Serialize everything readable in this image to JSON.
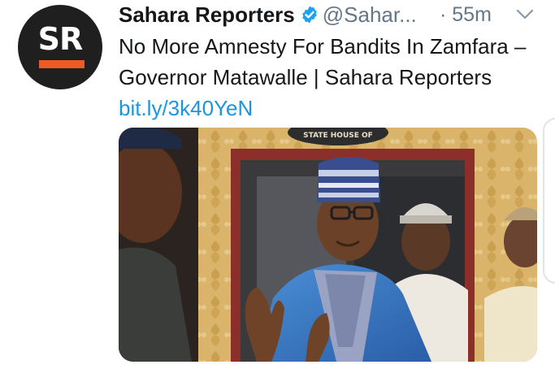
{
  "tweet": {
    "avatar_text": "SR",
    "display_name": "Sahara Reporters",
    "handle": "@Sahar...",
    "timestamp": "· 55m",
    "text": "No More Amnesty For Bandits In Zamfara – Governor Matawalle | Sahara Reporters",
    "link": "bit.ly/3k40YeN",
    "media_sign_text": "STATE HOUSE OF"
  },
  "colors": {
    "brand_orange": "#ef5a24",
    "verified_blue": "#1da1f2",
    "link_blue": "#1b95e0",
    "muted_gray": "#657786"
  },
  "icons": [
    "verified-badge-icon",
    "chevron-down-icon"
  ]
}
